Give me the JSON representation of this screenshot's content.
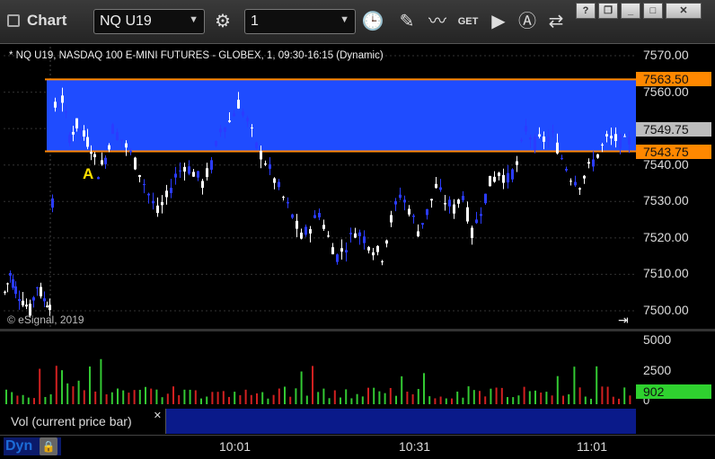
{
  "toolbar": {
    "app_title": "Chart",
    "symbol": "NQ U19",
    "interval": "1",
    "get_label": "GET"
  },
  "chart": {
    "header": "* NQ U19, NASDAQ 100 E-MINI FUTURES - GLOBEX, 1, 09:30-16:15 (Dynamic)",
    "copyright": "© eSignal, 2019",
    "annotation": "A",
    "price_axis": [
      "7570.00",
      "7560.00",
      "7540.00",
      "7530.00",
      "7520.00",
      "7510.00",
      "7500.00"
    ],
    "markers": [
      {
        "text": "7563.50",
        "color": "#ff8800",
        "price": 7563.5
      },
      {
        "text": "7549.75",
        "color": "#bdbdbd",
        "price": 7549.75
      },
      {
        "text": "7543.75",
        "color": "#ff8800",
        "price": 7543.75
      }
    ],
    "range_band": {
      "high": 7563.5,
      "low": 7543.75,
      "color": "#1f4cff"
    }
  },
  "volume": {
    "label": "Vol (current price bar)",
    "axis": [
      "5000",
      "2500",
      "0"
    ],
    "current": "902"
  },
  "time_axis": {
    "dyn_label": "Dyn",
    "labels": [
      "10:01",
      "10:31",
      "11:01"
    ]
  }
}
